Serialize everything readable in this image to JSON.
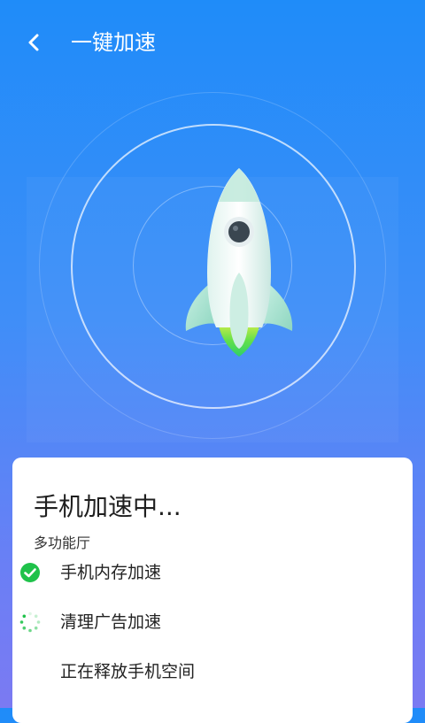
{
  "header": {
    "back_icon": "chevron-left-icon",
    "title": "一键加速"
  },
  "stage": {
    "rocket_icon": "rocket-icon"
  },
  "card": {
    "title": "手机加速中...",
    "subtitle": "多功能厅",
    "tasks": [
      {
        "label": "手机内存加速",
        "status": "done",
        "icon": "check-circle-icon"
      },
      {
        "label": "清理广告加速",
        "status": "in-progress",
        "icon": "spinner-icon"
      },
      {
        "label": "正在释放手机空间",
        "status": "pending",
        "icon": ""
      }
    ]
  },
  "colors": {
    "accent": "#1f8cf9",
    "success": "#1fc24a",
    "text": "#1f1f1f"
  }
}
